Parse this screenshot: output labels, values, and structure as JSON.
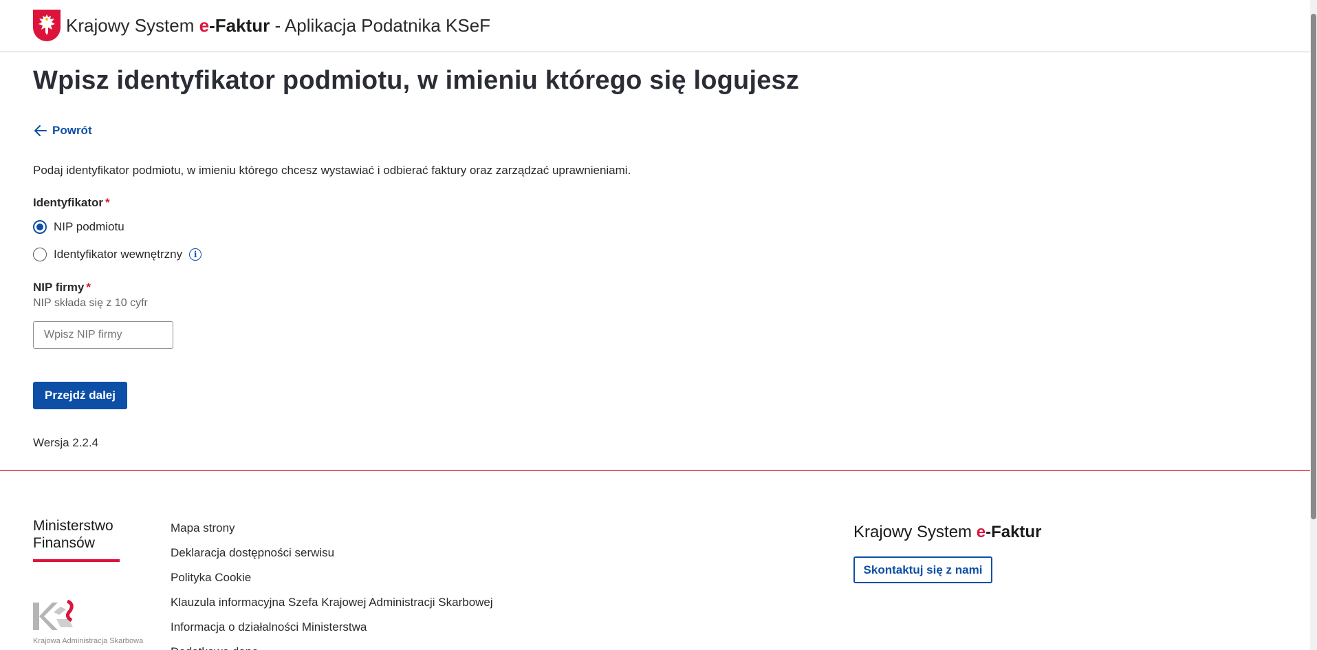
{
  "header": {
    "title_prefix": "Krajowy System",
    "title_e": "e",
    "title_faktur": "-Faktur",
    "title_suffix": " - Aplikacja Podatnika KSeF",
    "emblem_icon": "polish-eagle-icon"
  },
  "main": {
    "page_title": "Wpisz identyfikator podmiotu, w imieniu którego się logujesz",
    "back_label": "Powrót",
    "intro": "Podaj identyfikator podmiotu, w imieniu którego chcesz wystawiać i odbierać faktury oraz zarządzać uprawnieniami.",
    "identifier_label": "Identyfikator",
    "required_mark": "*",
    "radio_options": [
      {
        "label": "NIP podmiotu",
        "checked": true
      },
      {
        "label": "Identyfikator wewnętrzny",
        "checked": false
      }
    ],
    "nip_label": "NIP firmy",
    "nip_hint": "NIP składa się z 10 cyfr",
    "nip_placeholder": "Wpisz NIP firmy",
    "nip_value": "",
    "submit_label": "Przejdź dalej",
    "version": "Wersja 2.2.4"
  },
  "footer": {
    "ministry_line1": "Ministerstwo",
    "ministry_line2": "Finansów",
    "kas_text": "Krajowa Administracja Skarbowa",
    "links": [
      "Mapa strony",
      "Deklaracja dostępności serwisu",
      "Polityka Cookie",
      "Klauzula informacyjna Szefa Krajowej Administracji Skarbowej",
      "Informacja o działalności Ministerstwa",
      "Dodatkowe dane"
    ],
    "ksef_prefix": "Krajowy System ",
    "ksef_e": "e",
    "ksef_faktur": "-Faktur",
    "contact_label": "Skontaktuj się z nami"
  },
  "colors": {
    "primary": "#0d4fa6",
    "accent": "#dc143c"
  }
}
